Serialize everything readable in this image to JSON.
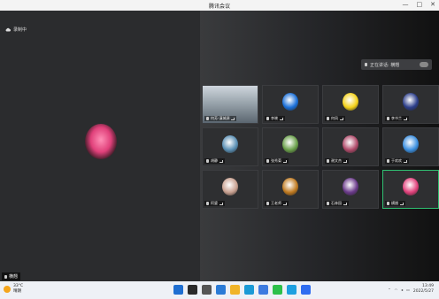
{
  "window": {
    "title": "腾讯会议",
    "controls": [
      "—",
      "□",
      "✕"
    ]
  },
  "recording": {
    "label": "录制中"
  },
  "speaker_banner": {
    "label": "正在讲话: 横翘"
  },
  "main_video": {
    "name": "横翘"
  },
  "participants": [
    {
      "name": "何芳-滇城源",
      "icon": "laptop-icon",
      "kind": "photo"
    },
    {
      "name": "李晓",
      "icon": "globe-icon",
      "kind": "avatar",
      "color": "#1a6fd8"
    },
    {
      "name": "何凤",
      "icon": "smiley-icon",
      "kind": "avatar",
      "color": "#f4d21a"
    },
    {
      "name": "李书兰",
      "icon": "text-card-icon",
      "kind": "avatar",
      "color": "#2c3e8a"
    },
    {
      "name": "胡静",
      "icon": "landscape-icon",
      "kind": "avatar",
      "color": "#5a8fb4"
    },
    {
      "name": "张秀菊",
      "icon": "flower-icon",
      "kind": "avatar",
      "color": "#6aa04a"
    },
    {
      "name": "谢文杰",
      "icon": "rose-icon",
      "kind": "avatar",
      "color": "#b04a6a"
    },
    {
      "name": "于欢欢",
      "icon": "pie-icon",
      "kind": "avatar",
      "color": "#3b8fe0"
    },
    {
      "name": "阿婆",
      "icon": "family-icon",
      "kind": "avatar",
      "color": "#c8a090"
    },
    {
      "name": "王老师",
      "icon": "bouquet-icon",
      "kind": "avatar",
      "color": "#c07a20"
    },
    {
      "name": "石林园",
      "icon": "grapes-icon",
      "kind": "avatar",
      "color": "#6a3a8a"
    },
    {
      "name": "横翘",
      "icon": "lotus-icon",
      "kind": "avatar",
      "color": "#e0407a",
      "active": true
    }
  ],
  "taskbar": {
    "weather_temp": "33°C",
    "weather_desc": "晴朗",
    "time": "13:49",
    "date": "2022/5/27",
    "apps": [
      {
        "name": "start-icon",
        "color": "#1f6fd1"
      },
      {
        "name": "search-icon",
        "color": "#2a2a2a"
      },
      {
        "name": "taskview-icon",
        "color": "#555"
      },
      {
        "name": "widgets-icon",
        "color": "#2b7bd6"
      },
      {
        "name": "explorer-icon",
        "color": "#f0b429"
      },
      {
        "name": "edge-icon",
        "color": "#1a9ad6"
      },
      {
        "name": "store-icon",
        "color": "#3d7be0"
      },
      {
        "name": "wechat-icon",
        "color": "#2dc04a"
      },
      {
        "name": "qq-icon",
        "color": "#1ea0e0"
      },
      {
        "name": "meeting-icon",
        "color": "#2f6df0"
      }
    ]
  }
}
